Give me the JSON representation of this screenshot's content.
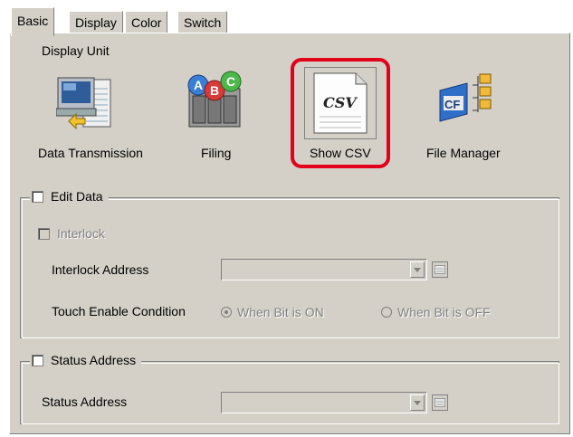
{
  "tabs": [
    "Basic",
    "Display",
    "Color",
    "Switch"
  ],
  "display_unit": {
    "label": "Display Unit",
    "items": [
      {
        "label": "Data Transmission",
        "icon": "data-transmission-icon"
      },
      {
        "label": "Filing",
        "icon": "filing-icon"
      },
      {
        "label": "Show CSV",
        "icon": "show-csv-icon",
        "badge": "CSV",
        "highlighted": true
      },
      {
        "label": "File Manager",
        "icon": "file-manager-icon",
        "badge": "CF"
      }
    ]
  },
  "edit_data": {
    "title": "Edit Data",
    "checked": false,
    "interlock_label": "Interlock",
    "interlock_address_label": "Interlock Address",
    "interlock_address_value": "",
    "touch_condition_label": "Touch Enable Condition",
    "option_on": "When Bit is ON",
    "option_off": "When Bit is OFF",
    "selected_option": "When Bit is ON"
  },
  "status_address": {
    "title": "Status Address",
    "checked": false,
    "field_label": "Status Address",
    "field_value": ""
  },
  "colors": {
    "highlight": "#e3001b",
    "panel": "#d4d0c8"
  }
}
